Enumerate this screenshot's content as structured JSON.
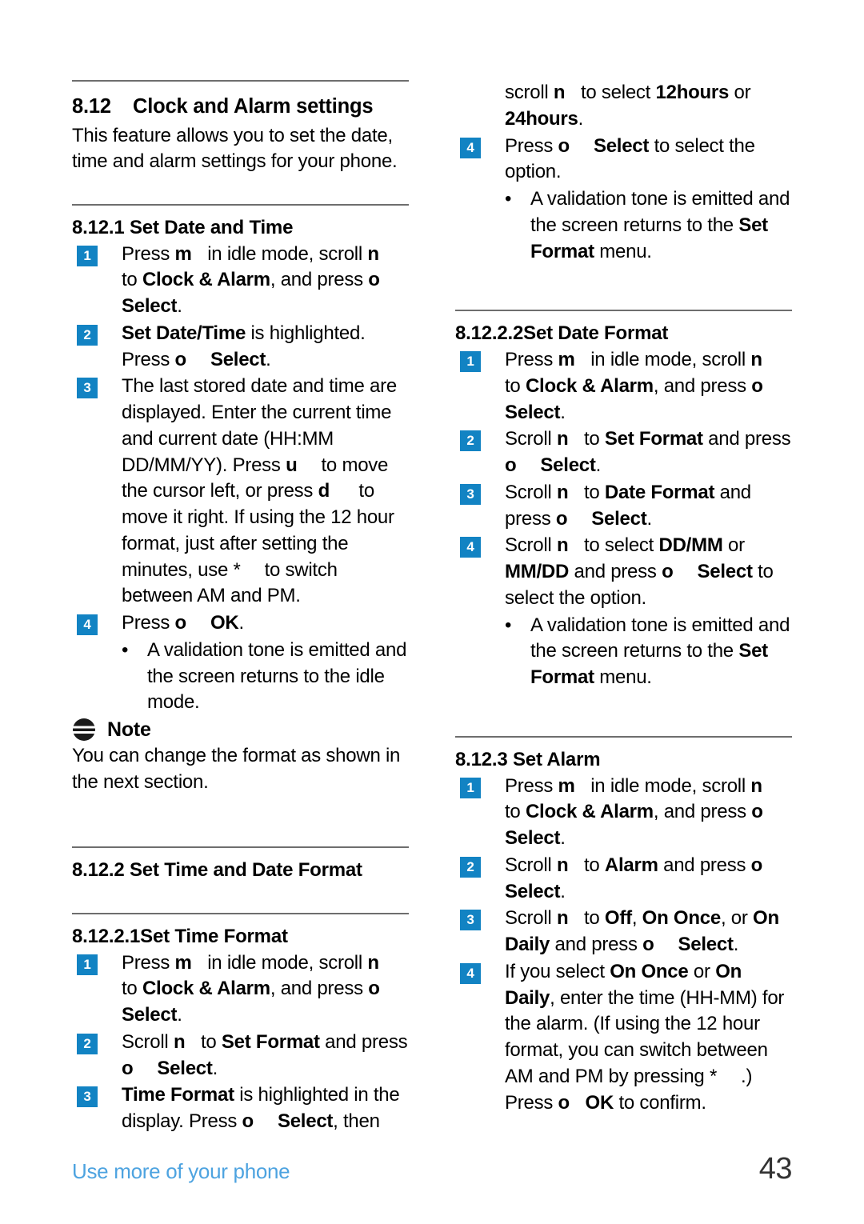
{
  "page": {
    "number": "43",
    "footer_label": "Use more of your phone",
    "accent_color": "#1283c3",
    "footer_color": "#4da3e0",
    "rule_color": "#6e6e6e"
  },
  "left_column": {
    "section": {
      "number": "8.12",
      "title": "Clock and Alarm settings",
      "intro": "This feature allows you to set the date, time and alarm settings for your phone."
    },
    "sub_8_12_1": {
      "number": "8.12.1",
      "title": "Set Date and Time",
      "steps": [
        {
          "marker": "1",
          "parts": [
            {
              "t": "Press ",
              "b": false
            },
            {
              "t": "m",
              "b": true
            },
            {
              "t": "sp",
              "b": false
            },
            {
              "t": " in idle mode, scroll ",
              "b": false
            },
            {
              "t": "n",
              "b": true
            },
            {
              "t": "sp",
              "b": false
            },
            {
              "t": " to ",
              "b": false
            },
            {
              "t": "Clock & Alarm",
              "b": true
            },
            {
              "t": ", and press ",
              "b": false
            },
            {
              "t": "o",
              "b": true
            },
            {
              "t": "sp",
              "b": false
            },
            {
              "t": " ",
              "b": false
            },
            {
              "t": "Select",
              "b": true
            },
            {
              "t": ".",
              "b": false
            }
          ]
        },
        {
          "marker": "2",
          "parts": [
            {
              "t": "Set Date/Time",
              "b": true
            },
            {
              "t": " is highlighted. Press ",
              "b": false
            },
            {
              "t": "o",
              "b": true
            },
            {
              "t": "sp-lg",
              "b": false
            },
            {
              "t": "Select",
              "b": true
            },
            {
              "t": ".",
              "b": false
            }
          ]
        },
        {
          "marker": "3",
          "parts": [
            {
              "t": "The last stored date and time are displayed. Enter the current time and current date (HH:MM DD/MM/YY). Press ",
              "b": false
            },
            {
              "t": "u",
              "b": true
            },
            {
              "t": "sp-lg",
              "b": false
            },
            {
              "t": "to move the cursor left, or press ",
              "b": false
            },
            {
              "t": "d",
              "b": true
            },
            {
              "t": "sp-lg",
              "b": false
            },
            {
              "t": " to move it right. If using the 12 hour format, just after setting the minutes, use ",
              "b": false
            },
            {
              "t": "*",
              "b": false
            },
            {
              "t": "sp-lg",
              "b": false
            },
            {
              "t": "to switch between AM and PM.",
              "b": false
            }
          ]
        },
        {
          "marker": "4",
          "parts": [
            {
              "t": "Press ",
              "b": false
            },
            {
              "t": "o",
              "b": true
            },
            {
              "t": "sp-lg",
              "b": false
            },
            {
              "t": "OK",
              "b": true
            },
            {
              "t": ".",
              "b": false
            }
          ]
        }
      ],
      "bullet": "A validation tone is emitted and the screen returns to the idle mode.",
      "note": {
        "icon": "note-stripes-icon",
        "title": "Note",
        "body": "You can change the format as shown in the next section."
      }
    },
    "sub_8_12_2": {
      "number": "8.12.2",
      "title": "Set Time and Date Format"
    },
    "sub_8_12_2_1": {
      "number": "8.12.2.1",
      "title": "Set Time Format",
      "steps": [
        {
          "marker": "1",
          "parts": [
            {
              "t": "Press ",
              "b": false
            },
            {
              "t": "m",
              "b": true
            },
            {
              "t": "sp",
              "b": false
            },
            {
              "t": " in idle mode, scroll ",
              "b": false
            },
            {
              "t": "n",
              "b": true
            },
            {
              "t": "sp",
              "b": false
            },
            {
              "t": " to ",
              "b": false
            },
            {
              "t": "Clock & Alarm",
              "b": true
            },
            {
              "t": ", and press ",
              "b": false
            },
            {
              "t": "o",
              "b": true
            },
            {
              "t": "sp",
              "b": false
            },
            {
              "t": " ",
              "b": false
            },
            {
              "t": "Select",
              "b": true
            },
            {
              "t": ".",
              "b": false
            }
          ]
        },
        {
          "marker": "2",
          "parts": [
            {
              "t": "Scroll ",
              "b": false
            },
            {
              "t": "n",
              "b": true
            },
            {
              "t": "sp",
              "b": false
            },
            {
              "t": " to ",
              "b": false
            },
            {
              "t": "Set Format",
              "b": true
            },
            {
              "t": " and press ",
              "b": false
            },
            {
              "t": "o",
              "b": true
            },
            {
              "t": "sp-lg",
              "b": false
            },
            {
              "t": "Select",
              "b": true
            },
            {
              "t": ".",
              "b": false
            }
          ]
        },
        {
          "marker": "3",
          "parts": [
            {
              "t": "Time Format",
              "b": true
            },
            {
              "t": " is highlighted in the display. Press ",
              "b": false
            },
            {
              "t": "o",
              "b": true
            },
            {
              "t": "sp-lg",
              "b": false
            },
            {
              "t": "Select",
              "b": true
            },
            {
              "t": ", then",
              "b": false
            }
          ]
        }
      ]
    }
  },
  "right_column": {
    "continuation": {
      "parts": [
        {
          "t": "scroll ",
          "b": false
        },
        {
          "t": "n",
          "b": true
        },
        {
          "t": "sp",
          "b": false
        },
        {
          "t": " to select ",
          "b": false
        },
        {
          "t": "12hours",
          "b": true
        },
        {
          "t": " or ",
          "b": false
        },
        {
          "t": "24hours",
          "b": true
        },
        {
          "t": ".",
          "b": false
        }
      ]
    },
    "continuation_steps": [
      {
        "marker": "4",
        "parts": [
          {
            "t": "Press ",
            "b": false
          },
          {
            "t": "o",
            "b": true
          },
          {
            "t": "sp-lg",
            "b": false
          },
          {
            "t": "Select",
            "b": true
          },
          {
            "t": " to select the option.",
            "b": false
          }
        ]
      }
    ],
    "continuation_bullet": {
      "parts": [
        {
          "t": "A validation tone is emitted and the screen returns to the ",
          "b": false
        },
        {
          "t": "Set Format",
          "b": true
        },
        {
          "t": " menu.",
          "b": false
        }
      ]
    },
    "sub_8_12_2_2": {
      "number": "8.12.2.2",
      "title": "Set Date Format",
      "steps": [
        {
          "marker": "1",
          "parts": [
            {
              "t": "Press ",
              "b": false
            },
            {
              "t": "m",
              "b": true
            },
            {
              "t": "sp",
              "b": false
            },
            {
              "t": " in idle mode, scroll ",
              "b": false
            },
            {
              "t": "n",
              "b": true
            },
            {
              "t": "sp",
              "b": false
            },
            {
              "t": " to ",
              "b": false
            },
            {
              "t": "Clock & Alarm",
              "b": true
            },
            {
              "t": ", and press ",
              "b": false
            },
            {
              "t": "o",
              "b": true
            },
            {
              "t": "sp",
              "b": false
            },
            {
              "t": " ",
              "b": false
            },
            {
              "t": "Select",
              "b": true
            },
            {
              "t": ".",
              "b": false
            }
          ]
        },
        {
          "marker": "2",
          "parts": [
            {
              "t": "Scroll ",
              "b": false
            },
            {
              "t": "n",
              "b": true
            },
            {
              "t": "sp",
              "b": false
            },
            {
              "t": " to ",
              "b": false
            },
            {
              "t": "Set Format",
              "b": true
            },
            {
              "t": " and press ",
              "b": false
            },
            {
              "t": "o",
              "b": true
            },
            {
              "t": "sp-lg",
              "b": false
            },
            {
              "t": "Select",
              "b": true
            },
            {
              "t": ".",
              "b": false
            }
          ]
        },
        {
          "marker": "3",
          "parts": [
            {
              "t": "Scroll ",
              "b": false
            },
            {
              "t": "n",
              "b": true
            },
            {
              "t": "sp",
              "b": false
            },
            {
              "t": " to ",
              "b": false
            },
            {
              "t": "Date Format",
              "b": true
            },
            {
              "t": " and press ",
              "b": false
            },
            {
              "t": "o",
              "b": true
            },
            {
              "t": "sp-lg",
              "b": false
            },
            {
              "t": "Select",
              "b": true
            },
            {
              "t": ".",
              "b": false
            }
          ]
        },
        {
          "marker": "4",
          "parts": [
            {
              "t": "Scroll ",
              "b": false
            },
            {
              "t": "n",
              "b": true
            },
            {
              "t": "sp",
              "b": false
            },
            {
              "t": " to select ",
              "b": false
            },
            {
              "t": "DD/MM",
              "b": true
            },
            {
              "t": " or ",
              "b": false
            },
            {
              "t": "MM/DD",
              "b": true
            },
            {
              "t": " and press ",
              "b": false
            },
            {
              "t": "o",
              "b": true
            },
            {
              "t": "sp-lg",
              "b": false
            },
            {
              "t": "Select",
              "b": true
            },
            {
              "t": " to select the option.",
              "b": false
            }
          ]
        }
      ],
      "bullet": {
        "parts": [
          {
            "t": "A validation tone is emitted and the screen returns to the ",
            "b": false
          },
          {
            "t": "Set Format",
            "b": true
          },
          {
            "t": " menu.",
            "b": false
          }
        ]
      }
    },
    "sub_8_12_3": {
      "number": "8.12.3",
      "title": "Set Alarm",
      "steps": [
        {
          "marker": "1",
          "parts": [
            {
              "t": "Press ",
              "b": false
            },
            {
              "t": "m",
              "b": true
            },
            {
              "t": "sp",
              "b": false
            },
            {
              "t": " in idle mode, scroll ",
              "b": false
            },
            {
              "t": "n",
              "b": true
            },
            {
              "t": "sp",
              "b": false
            },
            {
              "t": " to ",
              "b": false
            },
            {
              "t": "Clock & Alarm",
              "b": true
            },
            {
              "t": ", and press ",
              "b": false
            },
            {
              "t": "o",
              "b": true
            },
            {
              "t": "sp",
              "b": false
            },
            {
              "t": " ",
              "b": false
            },
            {
              "t": "Select",
              "b": true
            },
            {
              "t": ".",
              "b": false
            }
          ]
        },
        {
          "marker": "2",
          "parts": [
            {
              "t": "Scroll ",
              "b": false
            },
            {
              "t": "n",
              "b": true
            },
            {
              "t": "sp",
              "b": false
            },
            {
              "t": " to ",
              "b": false
            },
            {
              "t": "Alarm",
              "b": true
            },
            {
              "t": " and press ",
              "b": false
            },
            {
              "t": "o",
              "b": true
            },
            {
              "t": "sp",
              "b": false
            },
            {
              "t": " ",
              "b": false
            },
            {
              "t": "Select",
              "b": true
            },
            {
              "t": ".",
              "b": false
            }
          ]
        },
        {
          "marker": "3",
          "parts": [
            {
              "t": "Scroll ",
              "b": false
            },
            {
              "t": "n",
              "b": true
            },
            {
              "t": "sp",
              "b": false
            },
            {
              "t": " to ",
              "b": false
            },
            {
              "t": "Off",
              "b": true
            },
            {
              "t": ", ",
              "b": false
            },
            {
              "t": "On Once",
              "b": true
            },
            {
              "t": ", or ",
              "b": false
            },
            {
              "t": "On Daily",
              "b": true
            },
            {
              "t": " and press ",
              "b": false
            },
            {
              "t": "o",
              "b": true
            },
            {
              "t": "sp-lg",
              "b": false
            },
            {
              "t": "Select",
              "b": true
            },
            {
              "t": ".",
              "b": false
            }
          ]
        },
        {
          "marker": "4",
          "parts": [
            {
              "t": "If you select ",
              "b": false
            },
            {
              "t": "On Once",
              "b": true
            },
            {
              "t": " or ",
              "b": false
            },
            {
              "t": "On Daily",
              "b": true
            },
            {
              "t": ", enter the time (HH-MM) for the alarm. (If using the 12 hour format, you can switch between AM and PM by pressing ",
              "b": false
            },
            {
              "t": "*",
              "b": false
            },
            {
              "t": "sp-lg",
              "b": false
            },
            {
              "t": ".) Press ",
              "b": false
            },
            {
              "t": "o",
              "b": true
            },
            {
              "t": "sp",
              "b": false
            },
            {
              "t": " ",
              "b": false
            },
            {
              "t": "OK",
              "b": true
            },
            {
              "t": " to confirm.",
              "b": false
            }
          ]
        }
      ]
    }
  }
}
